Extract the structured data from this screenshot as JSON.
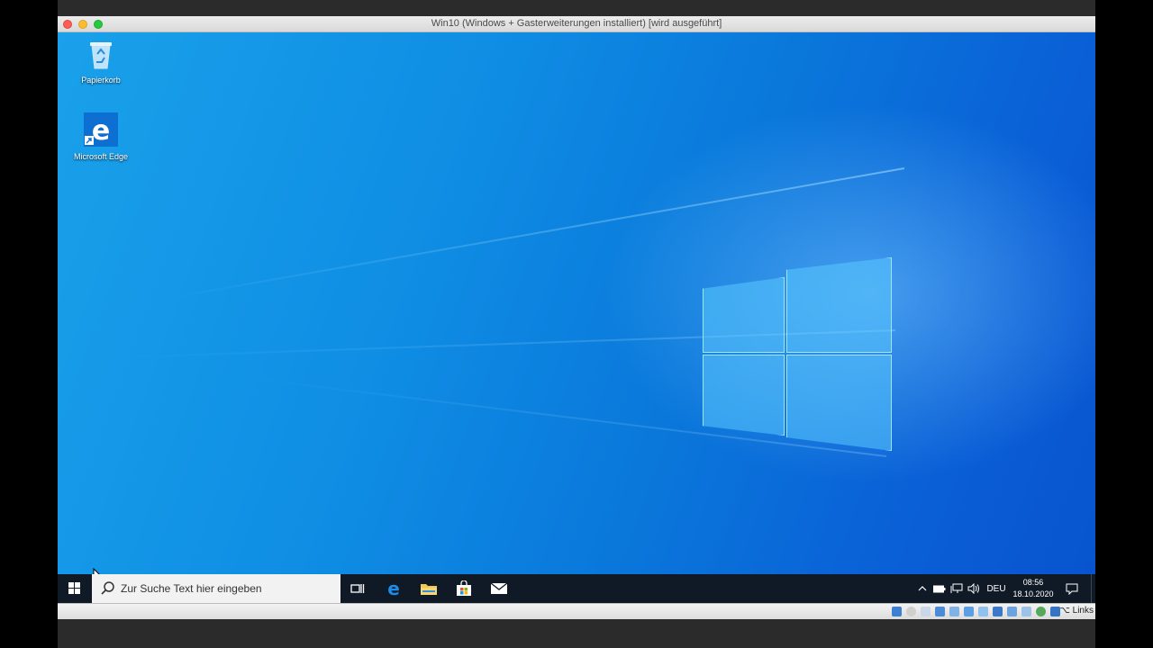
{
  "window": {
    "title": "Win10 (Windows + Gasterweiterungen installiert) [wird ausgeführt]"
  },
  "desktop": {
    "icons": [
      {
        "label": "Papierkorb",
        "icon": "recycle-bin-icon"
      },
      {
        "label": "Microsoft Edge",
        "icon": "edge-icon"
      }
    ]
  },
  "taskbar": {
    "search_placeholder": "Zur Suche Text hier eingeben",
    "pinned_apps": [
      "task-view-icon",
      "edge-icon",
      "file-explorer-icon",
      "store-icon",
      "mail-icon"
    ],
    "language": "DEU",
    "time": "08:56",
    "date": "18.10.2020"
  },
  "statusbar": {
    "host_key": "⌥ Links"
  },
  "colors": {
    "taskbar": "#101a27",
    "desktop_accent": "#0a78db",
    "edge_blue": "#0d6fd1"
  }
}
